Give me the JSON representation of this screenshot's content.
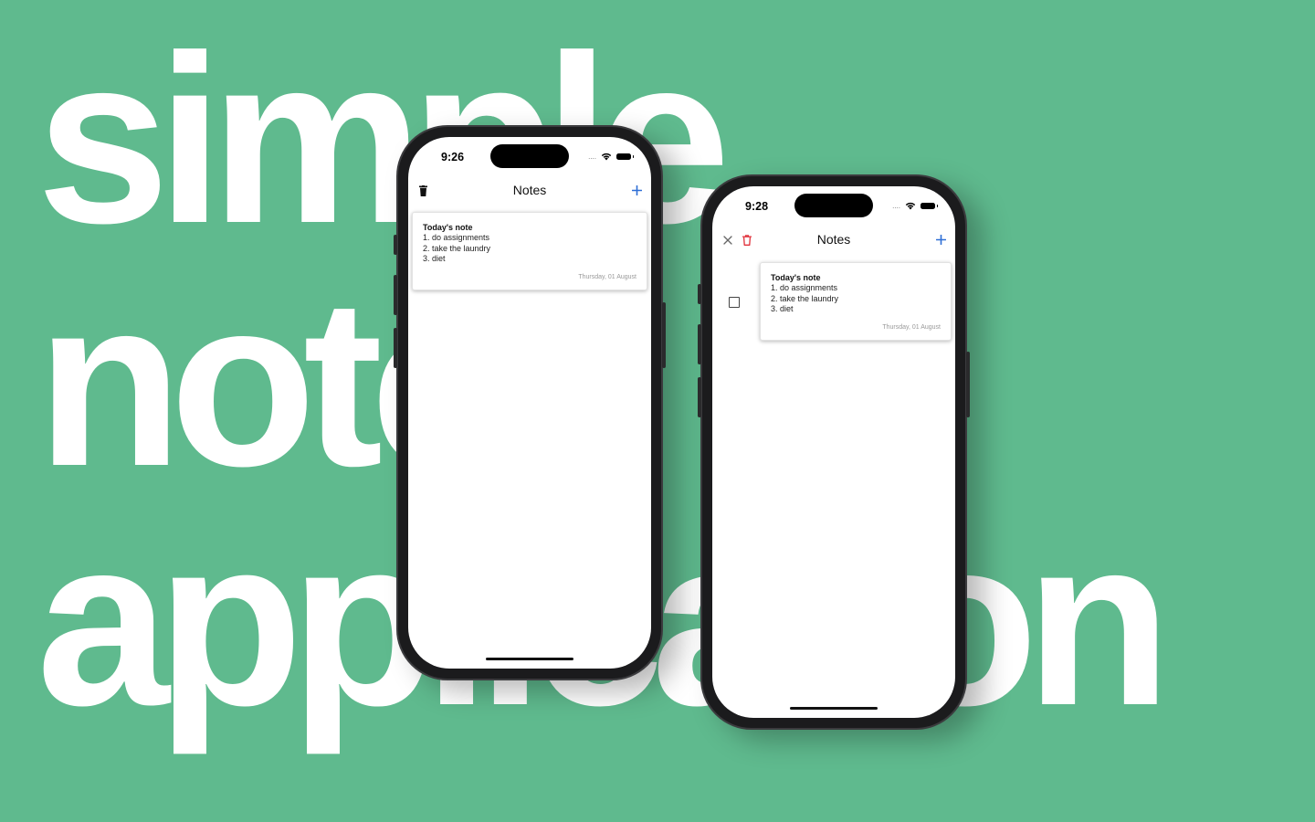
{
  "background": {
    "color": "#5fba8e",
    "words": [
      "simple",
      "notes",
      "application"
    ]
  },
  "phone1": {
    "time": "9:26",
    "signal_dots": "....",
    "nav": {
      "title": "Notes",
      "left_icon": "trash-icon",
      "right_icon": "plus-icon"
    },
    "notes": [
      {
        "title": "Today's note",
        "lines": [
          "1. do assignments",
          "2. take the laundry",
          "3. diet"
        ],
        "date": "Thursday, 01 August"
      }
    ]
  },
  "phone2": {
    "time": "9:28",
    "signal_dots": "....",
    "nav": {
      "title": "Notes",
      "left_icons": [
        "close-icon",
        "trash-icon"
      ],
      "right_icon": "plus-icon"
    },
    "notes": [
      {
        "title": "Today's note",
        "lines": [
          "1. do assignments",
          "2. take the laundry",
          "3. diet"
        ],
        "date": "Thursday, 01 August",
        "selected": false
      }
    ]
  },
  "colors": {
    "accent_blue": "#2f6fd6",
    "delete_red": "#e0303a"
  }
}
